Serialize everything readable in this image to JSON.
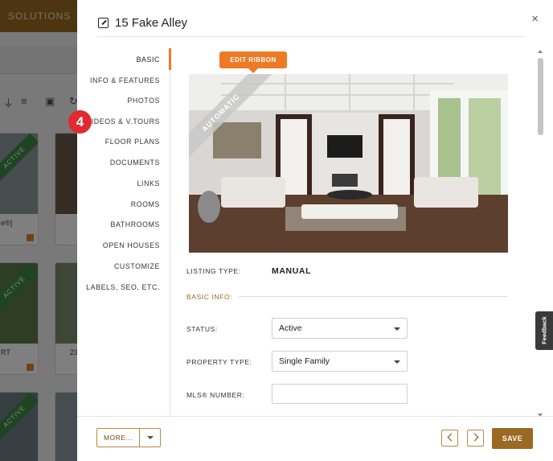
{
  "background": {
    "topbar_label": "SOLUTIONS",
    "card_ribbon": "ACTIVE",
    "card_labels": [
      "e®]",
      "RT",
      "23"
    ]
  },
  "modal": {
    "title": "15 Fake Alley",
    "title_icon": "edit-square-icon",
    "close_icon": "close-icon",
    "close_glyph": "×"
  },
  "step_badge": "4",
  "nav": {
    "active": "BASIC",
    "items": [
      {
        "label": "BASIC"
      },
      {
        "label": "INFO & FEATURES"
      },
      {
        "label": "PHOTOS"
      },
      {
        "label": "VIDEOS & V.TOURS"
      },
      {
        "label": "FLOOR PLANS"
      },
      {
        "label": "DOCUMENTS"
      },
      {
        "label": "LINKS"
      },
      {
        "label": "ROOMS"
      },
      {
        "label": "BATHROOMS"
      },
      {
        "label": "OPEN HOUSES"
      },
      {
        "label": "CUSTOMIZE"
      },
      {
        "label": "LABELS, SEO, ETC."
      }
    ]
  },
  "content": {
    "edit_ribbon_label": "EDIT RIBBON",
    "photo_ribbon": "AUTOMATIC",
    "listing_type_label": "LISTING TYPE:",
    "listing_type_value": "MANUAL",
    "basic_info_label": "BASIC INFO:",
    "status_label": "STATUS:",
    "status_value": "Active",
    "property_type_label": "PROPERTY TYPE:",
    "property_type_value": "Single Family",
    "mls_label": "MLS® NUMBER:",
    "mls_value": ""
  },
  "footer": {
    "more_label": "MORE...",
    "prev_icon": "chevron-left-icon",
    "next_icon": "chevron-right-icon",
    "save_label": "SAVE"
  },
  "feedback_label": "Feedback",
  "colors": {
    "brand": "#9a6a22",
    "accent_orange": "#ee7a26",
    "badge_red": "#df2a2e",
    "active_green": "#3d8a42"
  }
}
